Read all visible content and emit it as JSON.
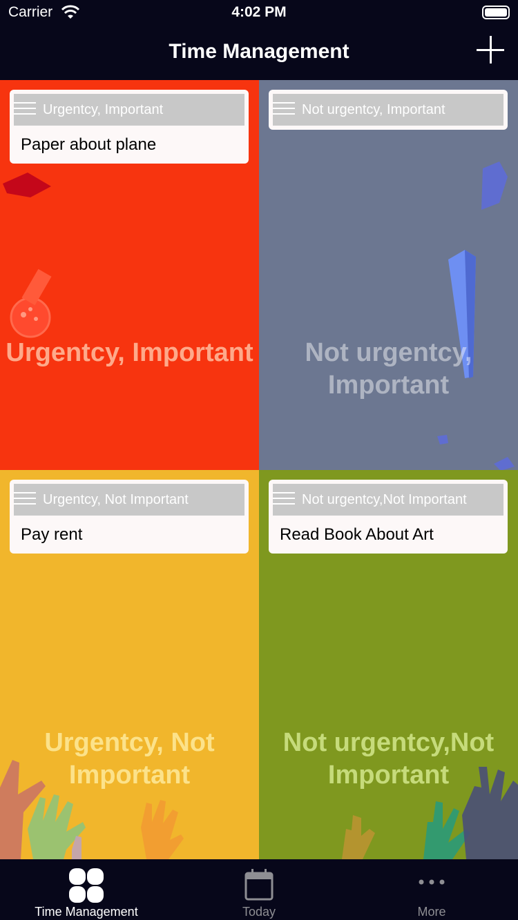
{
  "status_bar": {
    "carrier": "Carrier",
    "time": "4:02 PM"
  },
  "nav": {
    "title": "Time Management",
    "add_icon": "plus-icon"
  },
  "quadrants": [
    {
      "title": "Urgentcy, Important",
      "color": "#f7340f",
      "card": {
        "category": "Urgentcy, Important",
        "task": "Paper about plane"
      }
    },
    {
      "title": "Not urgentcy, Important",
      "color": "#6c7791",
      "card": {
        "category": "Not urgentcy, Important",
        "task": ""
      }
    },
    {
      "title": "Urgentcy, Not Important",
      "color": "#f1b62c",
      "card": {
        "category": "Urgentcy, Not Important",
        "task": "Pay rent"
      }
    },
    {
      "title": "Not urgentcy,Not Important",
      "color": "#7f981f",
      "card": {
        "category": "Not urgentcy,Not Important",
        "task": "Read Book About Art"
      }
    }
  ],
  "tabs": [
    {
      "label": "Time Management",
      "icon": "clover-grid-icon",
      "active": true
    },
    {
      "label": "Today",
      "icon": "calendar-icon",
      "active": false
    },
    {
      "label": "More",
      "icon": "more-dots-icon",
      "active": false
    }
  ]
}
